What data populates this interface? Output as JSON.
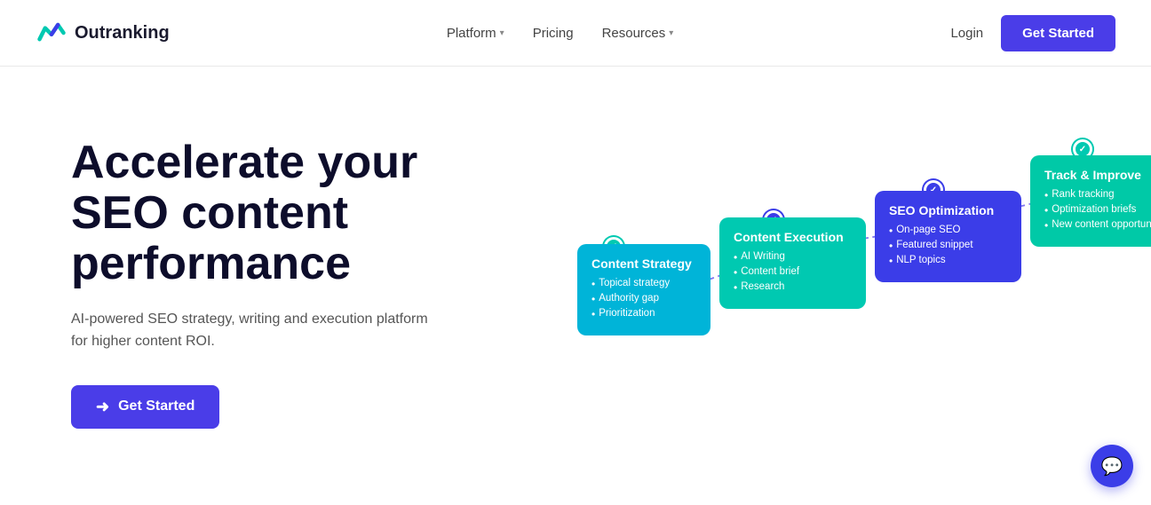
{
  "brand": {
    "name": "Outranking"
  },
  "nav": {
    "platform_label": "Platform",
    "pricing_label": "Pricing",
    "resources_label": "Resources",
    "login_label": "Login",
    "get_started_label": "Get Started"
  },
  "hero": {
    "title": "Accelerate your SEO content performance",
    "subtitle": "AI-powered SEO strategy, writing and execution platform for higher content ROI.",
    "cta_label": "Get Started"
  },
  "diagram": {
    "card_strategy": {
      "title": "Content Strategy",
      "items": [
        "Topical strategy",
        "Authority gap",
        "Prioritization"
      ]
    },
    "card_execution": {
      "title": "Content Execution",
      "items": [
        "AI Writing",
        "Content brief",
        "Research"
      ]
    },
    "card_seo": {
      "title": "SEO Optimization",
      "items": [
        "On-page SEO",
        "Featured snippet",
        "NLP topics"
      ]
    },
    "card_track": {
      "title": "Track & Improve",
      "items": [
        "Rank tracking",
        "Optimization briefs",
        "New content opportunities"
      ]
    }
  },
  "chat": {
    "icon": "💬"
  }
}
